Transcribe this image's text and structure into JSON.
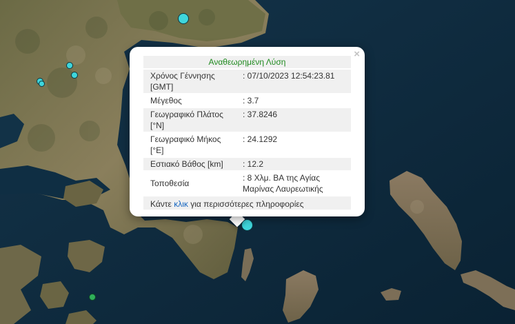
{
  "popup": {
    "close_label": "×",
    "header": "Αναθεωρημένη Λύση",
    "rows": [
      {
        "key": "Χρόνος Γέννησης [GMT]",
        "value": ": 07/10/2023 12:54:23.81"
      },
      {
        "key": "Μέγεθος",
        "value": ": 3.7"
      },
      {
        "key": "Γεωγραφικό Πλάτος [°N]",
        "value": ": 37.8246"
      },
      {
        "key": "Γεωγραφικό Μήκος [°E]",
        "value": ": 24.1292"
      },
      {
        "key": "Εστιακό Βάθος [km]",
        "value": ": 12.2"
      },
      {
        "key": "Τοποθεσία",
        "value": ": 8 Χλμ. ΒΑ της Αγίας Μαρίνας Λαυρεωτικής"
      }
    ],
    "footer_prefix": "Κάντε ",
    "footer_link": "κλικ",
    "footer_suffix": " για περισσότερες πληροφορίες"
  },
  "colors": {
    "sea": "#0c2a3e",
    "land": "#7d7a55",
    "marker_cyan": "#3fd6dc",
    "marker_green": "#2fb05a",
    "header_text": "#1f8a1f",
    "link": "#1565c0"
  }
}
